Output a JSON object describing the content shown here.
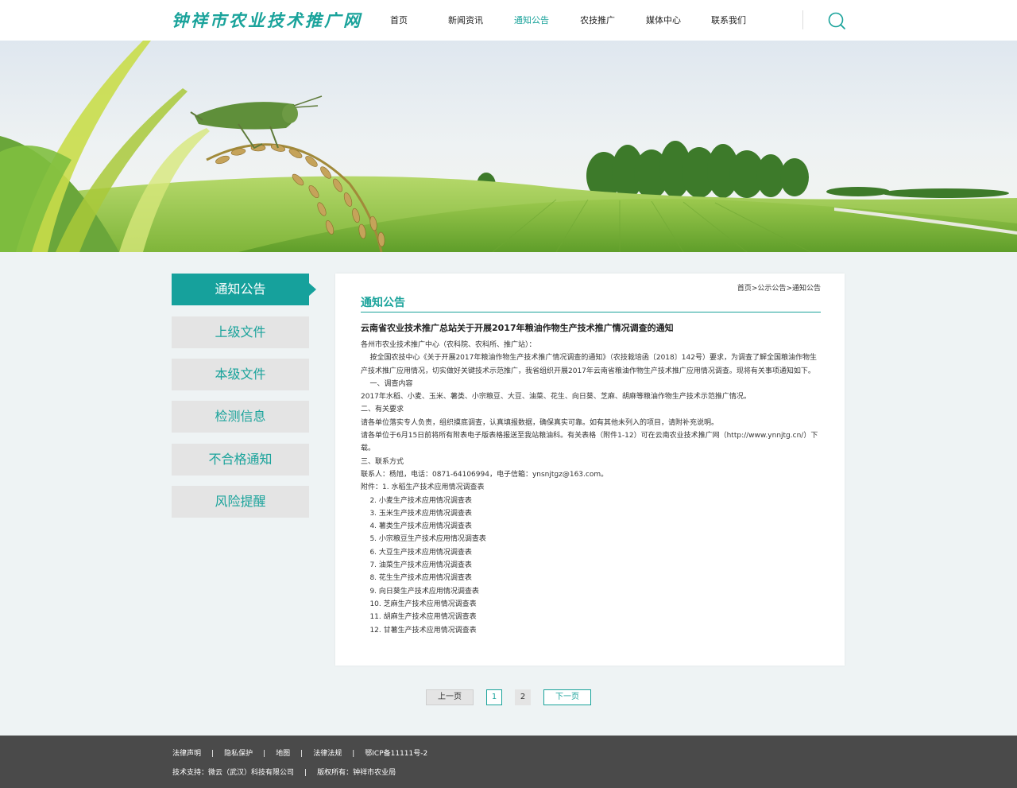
{
  "header": {
    "logo": "钟祥市农业技术推广网",
    "nav": [
      {
        "label": "首页",
        "active": false
      },
      {
        "label": "新闻资讯",
        "active": false
      },
      {
        "label": "通知公告",
        "active": true
      },
      {
        "label": "农技推广",
        "active": false
      },
      {
        "label": "媒体中心",
        "active": false
      },
      {
        "label": "联系我们",
        "active": false
      }
    ],
    "search_icon": "search-icon"
  },
  "sidebar": {
    "items": [
      {
        "label": "通知公告",
        "active": true
      },
      {
        "label": "上级文件",
        "active": false
      },
      {
        "label": "本级文件",
        "active": false
      },
      {
        "label": "检测信息",
        "active": false
      },
      {
        "label": "不合格通知",
        "active": false
      },
      {
        "label": "风险提醒",
        "active": false
      }
    ]
  },
  "content": {
    "breadcrumb": [
      "首页",
      ">",
      "公示公告",
      ">",
      "通知公告"
    ],
    "section_title": "通知公告",
    "article_title": "云南省农业技术推广总站关于开展2017年粮油作物生产技术推广情况调查的通知",
    "paragraphs": [
      "各州市农业技术推广中心（农科院、农科所、推广站）：",
      "    按全国农技中心《关于开展2017年粮油作物生产技术推广情况调查的通知》（农技栽培函〔2018〕142号）要求，为调查了解全国粮油作物生产技术推广应用情况，切实做好关键技术示范推广，我省组织开展2017年云南省粮油作物生产技术推广应用情况调查。现将有关事项通知如下。",
      "    一、调查内容",
      "2017年水稻、小麦、玉米、薯类、小宗粮豆、大豆、油菜、花生、向日葵、芝麻、胡麻等粮油作物生产技术示范推广情况。",
      "二、有关要求",
      "请各单位落实专人负责，组织摸底调查，认真填报数据，确保真实可靠。如有其他未列入的项目，请附补充说明。",
      "请各单位于6月15日前将所有附表电子版表格报送至我站粮油科。有关表格（附件1-12）可在云南农业技术推广网（http://www.ynnjtg.cn/）下载。",
      "三、联系方式",
      "联系人：杨旭，电话：0871-64106994，电子信箱：ynsnjtgz@163.com。",
      "附件：1. 水稻生产技术应用情况调查表",
      "    2. 小麦生产技术应用情况调查表",
      "    3. 玉米生产技术应用情况调查表",
      "    4. 薯类生产技术应用情况调查表",
      "    5. 小宗粮豆生产技术应用情况调查表",
      "    6. 大豆生产技术应用情况调查表",
      "    7. 油菜生产技术应用情况调查表",
      "    8. 花生生产技术应用情况调查表",
      "    9. 向日葵生产技术应用情况调查表",
      "    10. 芝麻生产技术应用情况调查表",
      "    11. 胡麻生产技术应用情况调查表",
      "    12. 甘薯生产技术应用情况调查表"
    ]
  },
  "pagination": {
    "prev": "上一页",
    "pages": [
      "1",
      "2"
    ],
    "current": "1",
    "next": "下一页"
  },
  "footer": {
    "links": [
      "法律声明",
      "隐私保护",
      "地图",
      "法律法规",
      "鄂ICP备11111号-2"
    ],
    "separator": "|",
    "support": "技术支持：微云（武汉）科技有限公司",
    "copyright": "版权所有：钟祥市农业局"
  },
  "colors": {
    "accent": "#1aa39b",
    "sidebar_inactive": "#e4e4e4",
    "footer_bg": "#4a4a4a",
    "page_bg": "#eef3f4"
  }
}
